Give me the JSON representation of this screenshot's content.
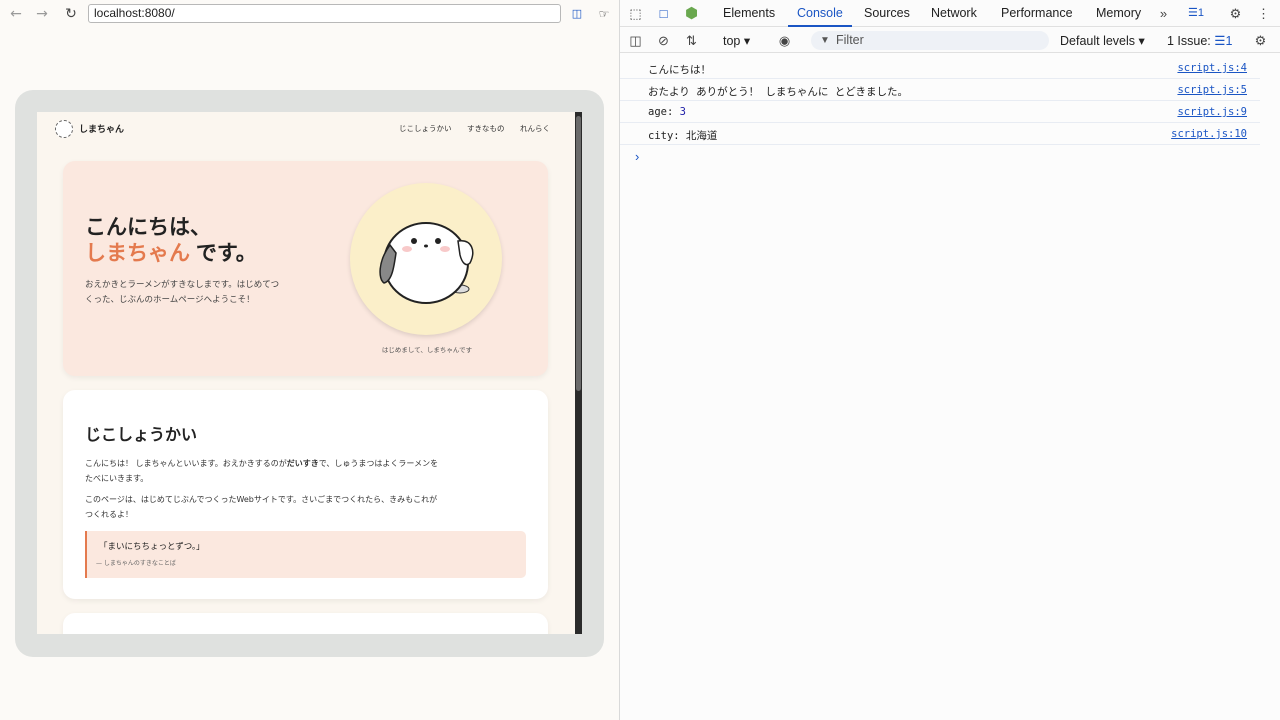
{
  "browser": {
    "url": "localhost:8080/"
  },
  "site": {
    "name": "しまちゃん",
    "nav": [
      "じこしょうかい",
      "すきなもの",
      "れんらく"
    ],
    "hero": {
      "title_line1": "こんにちは、",
      "title_accent": "しまちゃん",
      "title_suffix": " です。",
      "description": "おえかきとラーメンがすきなしまです。はじめてつくった、じぶんのホームページへようこそ！",
      "avatar_caption": "はじめまして、しまちゃんです"
    },
    "about": {
      "title": "じこしょうかい",
      "p1_before": "こんにちは！ しまちゃんといいます。おえかきするのが",
      "p1_bold": "だいすき",
      "p1_after": "で、しゅうまつはよくラーメンをたべにいきます。",
      "p2": "このページは、はじめてじぶんでつくったWebサイトです。さいごまでつくれたら、きみもこれがつくれるよ！",
      "quote": "「まいにちちょっとずつ。」",
      "quote_source": "— しまちゃんのすきなことば"
    }
  },
  "devtools": {
    "tabs": [
      "Elements",
      "Console",
      "Sources",
      "Network",
      "Performance",
      "Memory"
    ],
    "active_tab": "Console",
    "message_badge": "1",
    "context": "top",
    "filter_placeholder": "Filter",
    "levels": "Default levels",
    "issues_label": "1 Issue:",
    "issues_count": "1",
    "logs": [
      {
        "message": "こんにちは！",
        "source": "script.js:4"
      },
      {
        "message": "おたより ありがとう！ しまちゃんに とどきました。",
        "source": "script.js:5"
      },
      {
        "key": "age: ",
        "value": "3",
        "source": "script.js:9"
      },
      {
        "message": "city: 北海道",
        "source": "script.js:10"
      }
    ],
    "colors": {
      "accent": "#1a55c4"
    }
  }
}
